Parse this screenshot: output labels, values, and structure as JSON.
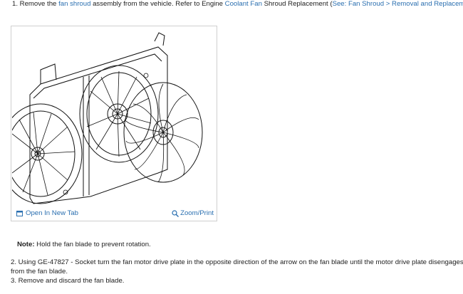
{
  "step1": {
    "prefix": "1. Remove the ",
    "link1": "fan shroud",
    "mid1": " assembly from the vehicle. Refer to Engine ",
    "link2": "Coolant Fan",
    "mid2": " Shroud Replacement (",
    "link3": "See: Fan Shroud > Removal and Replacement",
    "suffix": ")."
  },
  "figure": {
    "open_tab_label": "Open In New Tab",
    "zoom_label": "Zoom/Print",
    "open_tab_icon": "open-in-new-tab-icon",
    "zoom_icon": "magnifier-icon"
  },
  "note": {
    "label": "Note:",
    "text": " Hold the fan blade to prevent rotation."
  },
  "step2": {
    "line1": "2. Using GE-47827 - Socket turn the fan motor drive plate in the opposite direction of the arrow on the fan blade until the motor drive plate disengages",
    "line2": "from the fan blade."
  },
  "step3": {
    "text": "3. Remove and discard the fan blade."
  },
  "colors": {
    "link": "#2a6fb0",
    "text": "#222222",
    "border": "#cfcfcf"
  }
}
